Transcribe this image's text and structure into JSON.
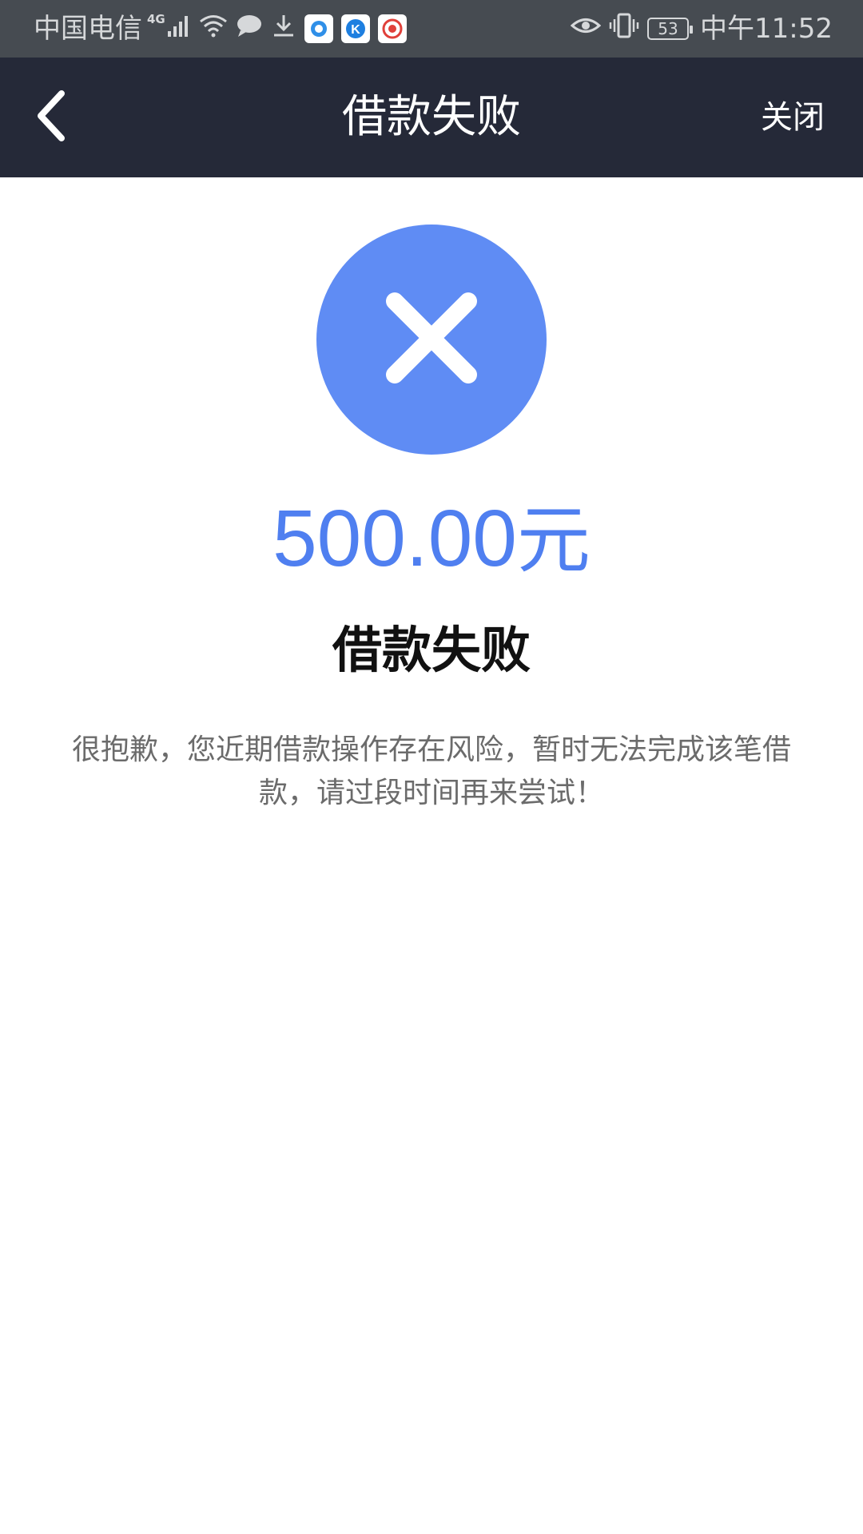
{
  "status_bar": {
    "carrier": "中国电信",
    "network": "4G",
    "battery": "53",
    "time": "中午11:52",
    "icons": [
      "signal-icon",
      "wifi-icon",
      "message-icon",
      "download-icon",
      "app-icon-browser",
      "app-icon-k",
      "app-icon-weibo",
      "eye-icon",
      "vibrate-icon",
      "battery-icon"
    ]
  },
  "nav": {
    "title": "借款失败",
    "close_label": "关闭",
    "back_icon": "chevron-left-icon"
  },
  "result": {
    "icon": "close-icon",
    "icon_color": "#5f8cf4",
    "amount": "500.00",
    "amount_unit": "元",
    "amount_color": "#4f7ff0",
    "title": "借款失败",
    "description": "很抱歉，您近期借款操作存在风险，暂时无法完成该笔借款，请过段时间再来尝试！"
  }
}
